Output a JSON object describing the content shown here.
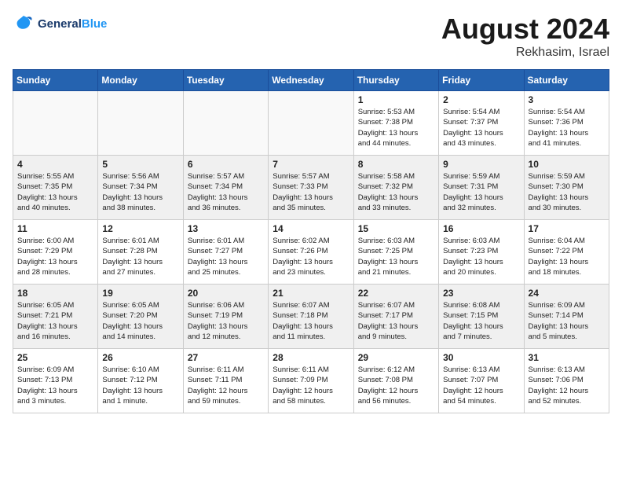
{
  "header": {
    "logo_line1": "General",
    "logo_line2": "Blue",
    "month": "August 2024",
    "location": "Rekhasim, Israel"
  },
  "weekdays": [
    "Sunday",
    "Monday",
    "Tuesday",
    "Wednesday",
    "Thursday",
    "Friday",
    "Saturday"
  ],
  "weeks": [
    [
      {
        "day": "",
        "info": ""
      },
      {
        "day": "",
        "info": ""
      },
      {
        "day": "",
        "info": ""
      },
      {
        "day": "",
        "info": ""
      },
      {
        "day": "1",
        "info": "Sunrise: 5:53 AM\nSunset: 7:38 PM\nDaylight: 13 hours\nand 44 minutes."
      },
      {
        "day": "2",
        "info": "Sunrise: 5:54 AM\nSunset: 7:37 PM\nDaylight: 13 hours\nand 43 minutes."
      },
      {
        "day": "3",
        "info": "Sunrise: 5:54 AM\nSunset: 7:36 PM\nDaylight: 13 hours\nand 41 minutes."
      }
    ],
    [
      {
        "day": "4",
        "info": "Sunrise: 5:55 AM\nSunset: 7:35 PM\nDaylight: 13 hours\nand 40 minutes."
      },
      {
        "day": "5",
        "info": "Sunrise: 5:56 AM\nSunset: 7:34 PM\nDaylight: 13 hours\nand 38 minutes."
      },
      {
        "day": "6",
        "info": "Sunrise: 5:57 AM\nSunset: 7:34 PM\nDaylight: 13 hours\nand 36 minutes."
      },
      {
        "day": "7",
        "info": "Sunrise: 5:57 AM\nSunset: 7:33 PM\nDaylight: 13 hours\nand 35 minutes."
      },
      {
        "day": "8",
        "info": "Sunrise: 5:58 AM\nSunset: 7:32 PM\nDaylight: 13 hours\nand 33 minutes."
      },
      {
        "day": "9",
        "info": "Sunrise: 5:59 AM\nSunset: 7:31 PM\nDaylight: 13 hours\nand 32 minutes."
      },
      {
        "day": "10",
        "info": "Sunrise: 5:59 AM\nSunset: 7:30 PM\nDaylight: 13 hours\nand 30 minutes."
      }
    ],
    [
      {
        "day": "11",
        "info": "Sunrise: 6:00 AM\nSunset: 7:29 PM\nDaylight: 13 hours\nand 28 minutes."
      },
      {
        "day": "12",
        "info": "Sunrise: 6:01 AM\nSunset: 7:28 PM\nDaylight: 13 hours\nand 27 minutes."
      },
      {
        "day": "13",
        "info": "Sunrise: 6:01 AM\nSunset: 7:27 PM\nDaylight: 13 hours\nand 25 minutes."
      },
      {
        "day": "14",
        "info": "Sunrise: 6:02 AM\nSunset: 7:26 PM\nDaylight: 13 hours\nand 23 minutes."
      },
      {
        "day": "15",
        "info": "Sunrise: 6:03 AM\nSunset: 7:25 PM\nDaylight: 13 hours\nand 21 minutes."
      },
      {
        "day": "16",
        "info": "Sunrise: 6:03 AM\nSunset: 7:23 PM\nDaylight: 13 hours\nand 20 minutes."
      },
      {
        "day": "17",
        "info": "Sunrise: 6:04 AM\nSunset: 7:22 PM\nDaylight: 13 hours\nand 18 minutes."
      }
    ],
    [
      {
        "day": "18",
        "info": "Sunrise: 6:05 AM\nSunset: 7:21 PM\nDaylight: 13 hours\nand 16 minutes."
      },
      {
        "day": "19",
        "info": "Sunrise: 6:05 AM\nSunset: 7:20 PM\nDaylight: 13 hours\nand 14 minutes."
      },
      {
        "day": "20",
        "info": "Sunrise: 6:06 AM\nSunset: 7:19 PM\nDaylight: 13 hours\nand 12 minutes."
      },
      {
        "day": "21",
        "info": "Sunrise: 6:07 AM\nSunset: 7:18 PM\nDaylight: 13 hours\nand 11 minutes."
      },
      {
        "day": "22",
        "info": "Sunrise: 6:07 AM\nSunset: 7:17 PM\nDaylight: 13 hours\nand 9 minutes."
      },
      {
        "day": "23",
        "info": "Sunrise: 6:08 AM\nSunset: 7:15 PM\nDaylight: 13 hours\nand 7 minutes."
      },
      {
        "day": "24",
        "info": "Sunrise: 6:09 AM\nSunset: 7:14 PM\nDaylight: 13 hours\nand 5 minutes."
      }
    ],
    [
      {
        "day": "25",
        "info": "Sunrise: 6:09 AM\nSunset: 7:13 PM\nDaylight: 13 hours\nand 3 minutes."
      },
      {
        "day": "26",
        "info": "Sunrise: 6:10 AM\nSunset: 7:12 PM\nDaylight: 13 hours\nand 1 minute."
      },
      {
        "day": "27",
        "info": "Sunrise: 6:11 AM\nSunset: 7:11 PM\nDaylight: 12 hours\nand 59 minutes."
      },
      {
        "day": "28",
        "info": "Sunrise: 6:11 AM\nSunset: 7:09 PM\nDaylight: 12 hours\nand 58 minutes."
      },
      {
        "day": "29",
        "info": "Sunrise: 6:12 AM\nSunset: 7:08 PM\nDaylight: 12 hours\nand 56 minutes."
      },
      {
        "day": "30",
        "info": "Sunrise: 6:13 AM\nSunset: 7:07 PM\nDaylight: 12 hours\nand 54 minutes."
      },
      {
        "day": "31",
        "info": "Sunrise: 6:13 AM\nSunset: 7:06 PM\nDaylight: 12 hours\nand 52 minutes."
      }
    ]
  ]
}
